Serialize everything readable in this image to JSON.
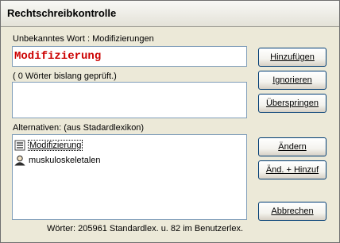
{
  "window": {
    "title": "Rechtschreibkontrolle"
  },
  "unknown_word": {
    "label": "Unbekanntes Wort : Modifizierungen",
    "value": "Modifizierung"
  },
  "progress": {
    "label": "( 0 Wörter bislang geprüft.)"
  },
  "alternatives": {
    "label": "Alternativen:  (aus Stadardlexikon)",
    "items": [
      {
        "text": "Modifizierung",
        "icon": "dictionary-icon",
        "selected": true
      },
      {
        "text": "muskuloskeletalen",
        "icon": "person-icon",
        "selected": false
      }
    ]
  },
  "buttons": {
    "add": "Hinzufügen",
    "ignore": "Ignorieren",
    "skip": "Überspringen",
    "change": "Ändern",
    "change_add": "Änd. + Hinzuf",
    "cancel": "Abbrechen"
  },
  "status": "Wörter: 205961 Standardlex. u. 82 im Benutzerlex."
}
